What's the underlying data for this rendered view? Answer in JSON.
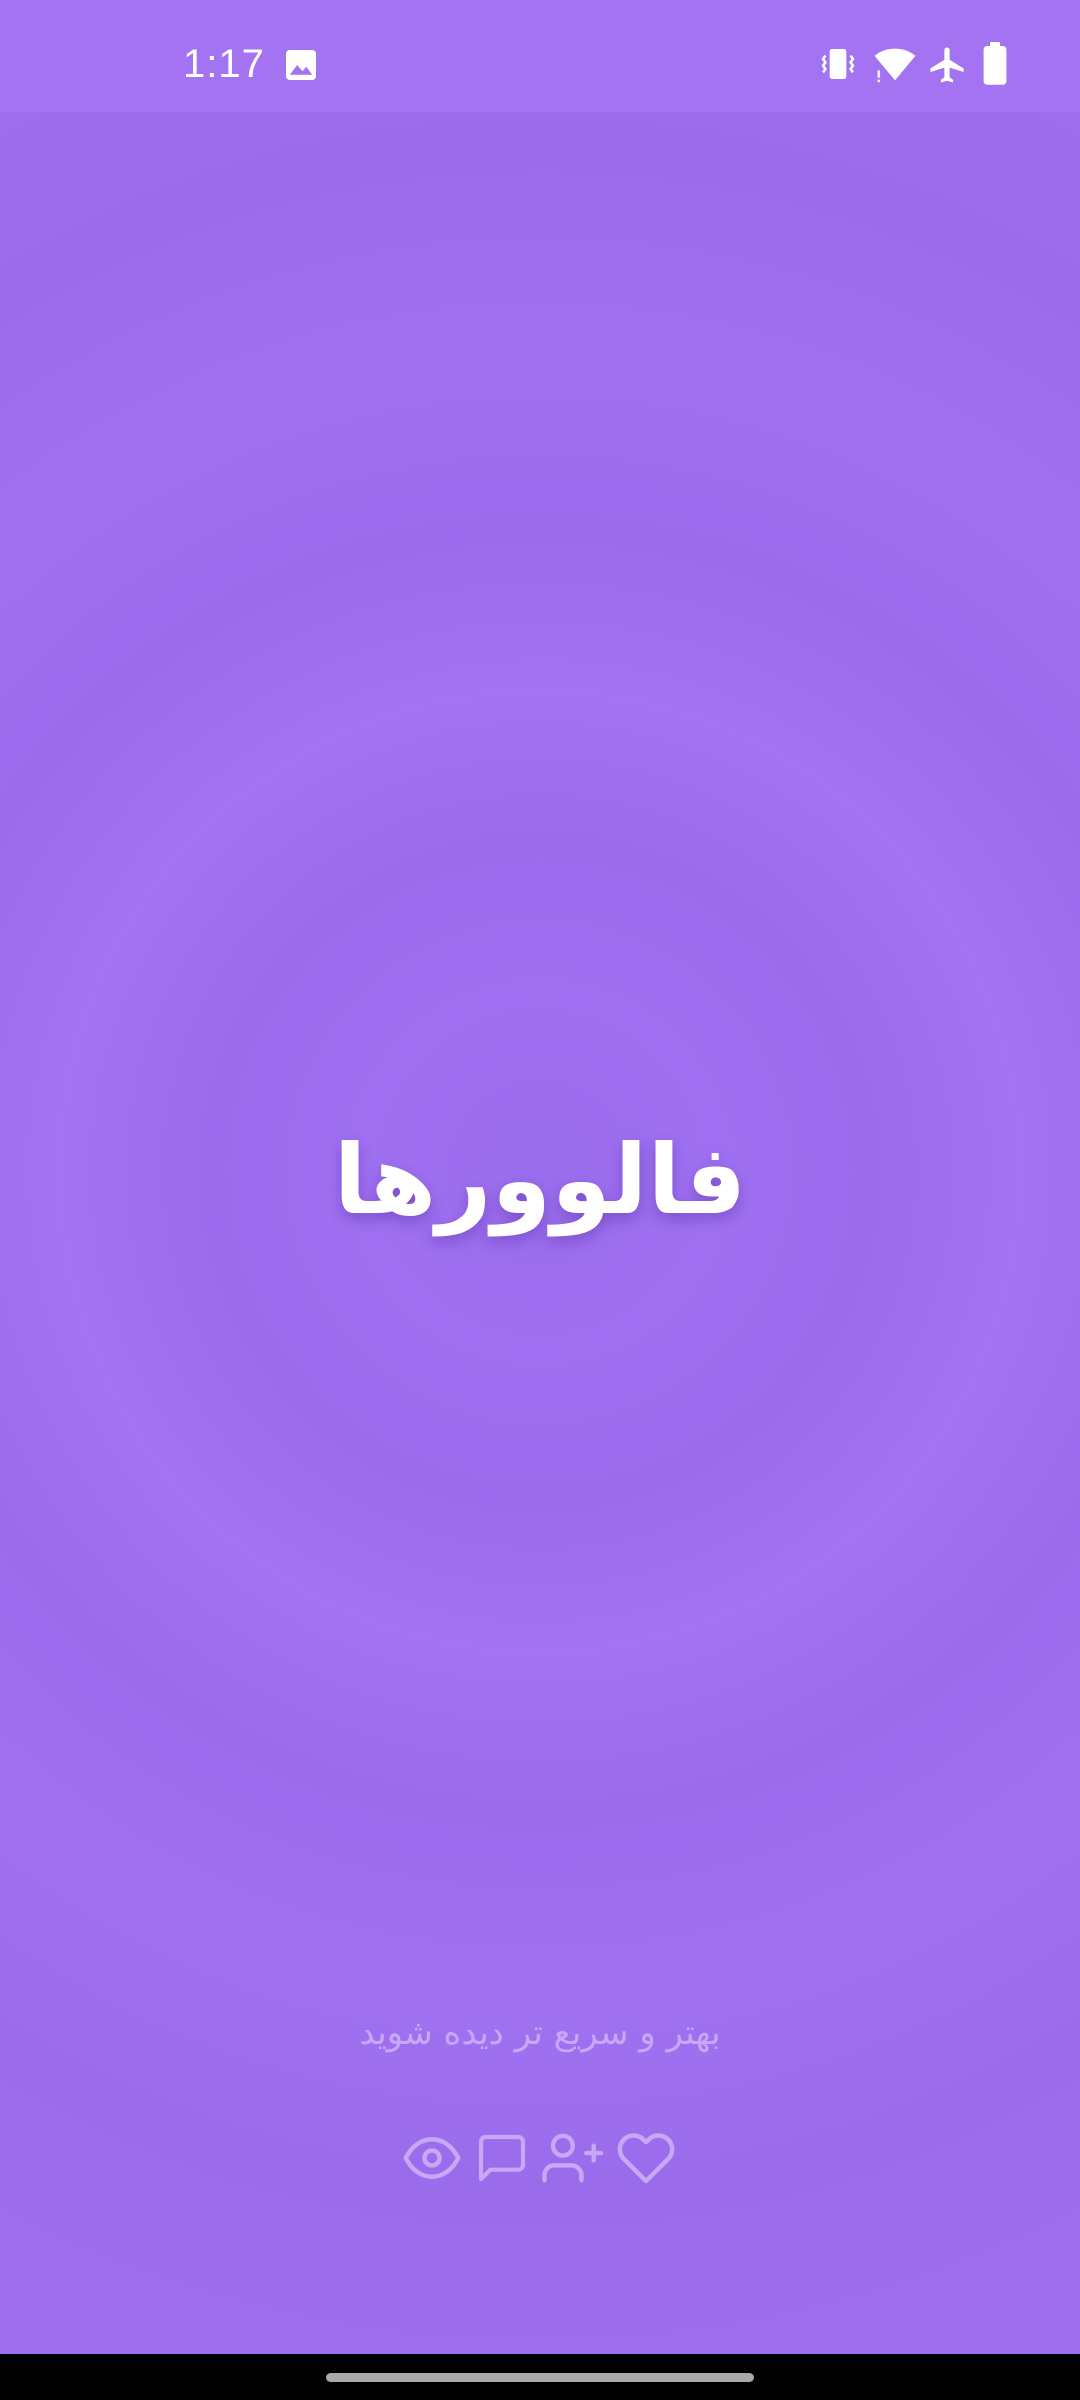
{
  "status_bar": {
    "time": "1:17",
    "icons": [
      "image-icon",
      "vibrate-icon",
      "wifi-icon",
      "airplane-mode-icon",
      "battery-icon"
    ]
  },
  "splash": {
    "title": "فالوورها",
    "tagline": "بهتر و سریع تر دیده شوید",
    "feature_icons": [
      "eye-icon",
      "comment-icon",
      "add-user-icon",
      "heart-icon"
    ]
  },
  "colors": {
    "background": "#9d6fef",
    "status_bar": "#a373f2",
    "title": "#ffffff",
    "tagline": "#c6a8f6",
    "feature_icon": "#c6a8f6"
  }
}
